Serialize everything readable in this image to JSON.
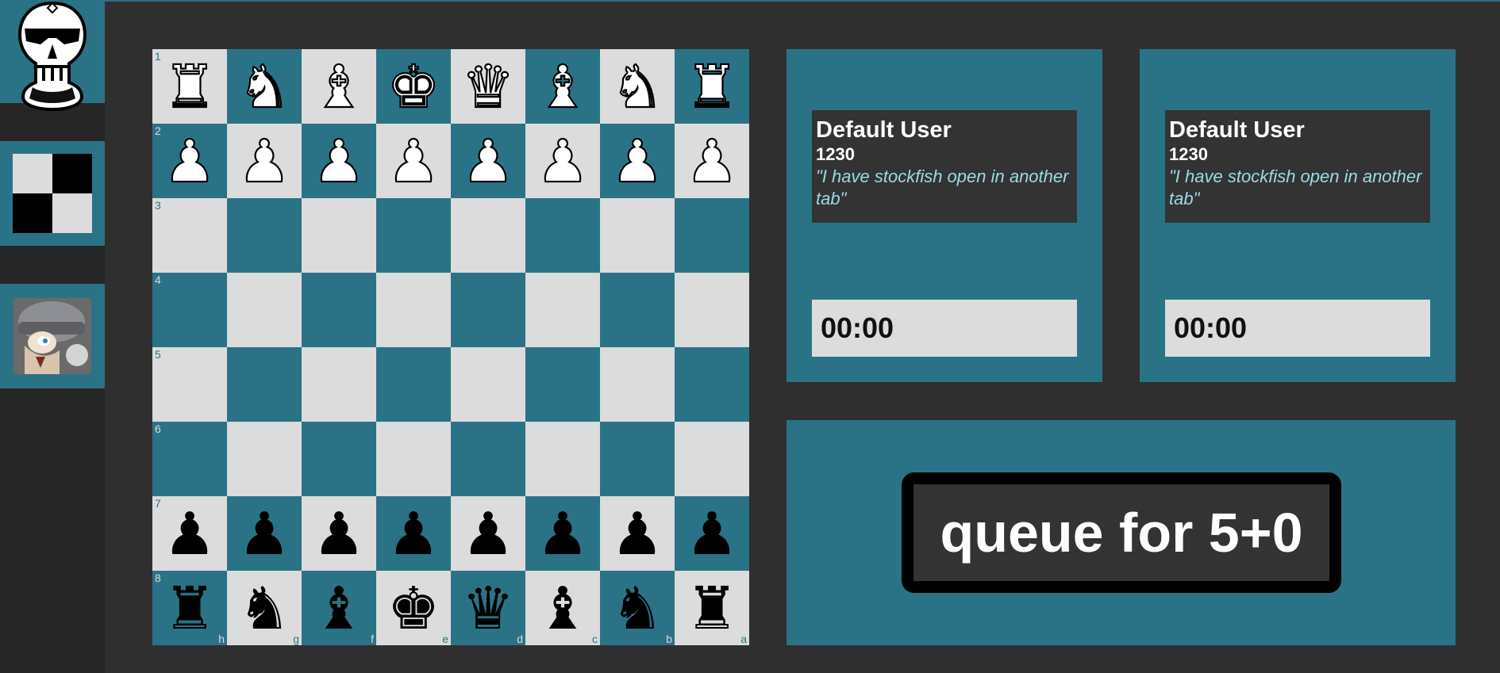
{
  "sidebar": {
    "items": [
      {
        "name": "logo",
        "icon": "masked-pawn-logo-icon"
      },
      {
        "name": "board-theme",
        "icon": "checkerboard-icon"
      },
      {
        "name": "profile",
        "icon": "avatar-icon"
      }
    ]
  },
  "board": {
    "light_color": "#dcdcdc",
    "dark_color": "#2a7386",
    "rank_labels": [
      "1",
      "2",
      "3",
      "4",
      "5",
      "6",
      "7",
      "8"
    ],
    "file_labels": [
      "h",
      "g",
      "f",
      "e",
      "d",
      "c",
      "b",
      "a"
    ],
    "rows": [
      [
        "wR",
        "wN",
        "wB",
        "wK",
        "wQ",
        "wB",
        "wN",
        "wR"
      ],
      [
        "wP",
        "wP",
        "wP",
        "wP",
        "wP",
        "wP",
        "wP",
        "wP"
      ],
      [
        "",
        "",
        "",
        "",
        "",
        "",
        "",
        ""
      ],
      [
        "",
        "",
        "",
        "",
        "",
        "",
        "",
        ""
      ],
      [
        "",
        "",
        "",
        "",
        "",
        "",
        "",
        ""
      ],
      [
        "",
        "",
        "",
        "",
        "",
        "",
        "",
        ""
      ],
      [
        "bP",
        "bP",
        "bP",
        "bP",
        "bP",
        "bP",
        "bP",
        "bP"
      ],
      [
        "bR",
        "bN",
        "bB",
        "bK",
        "bQ",
        "bB",
        "bN",
        "bR"
      ]
    ]
  },
  "players": [
    {
      "name": "Default User",
      "rating": "1230",
      "quote": "\"I have stockfish open in another tab\"",
      "clock": "00:00"
    },
    {
      "name": "Default User",
      "rating": "1230",
      "quote": "\"I have stockfish open in another tab\"",
      "clock": "00:00"
    }
  ],
  "queue": {
    "label": "queue for 5+0"
  }
}
